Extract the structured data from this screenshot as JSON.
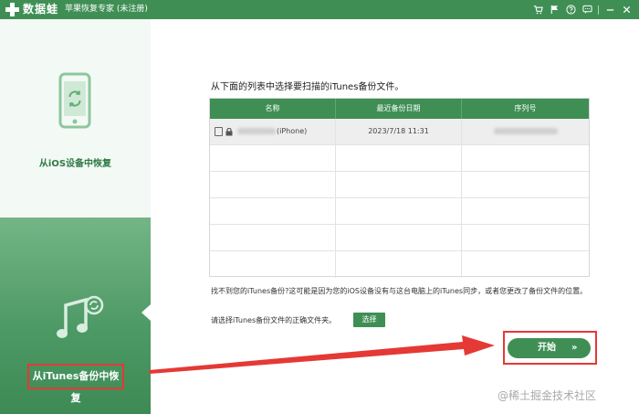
{
  "window": {
    "app_name": "数据蛙",
    "title": "苹果恢复专家 (未注册)",
    "icons": [
      "cart-icon",
      "flag-icon",
      "help-icon",
      "chat-icon",
      "minimize-icon",
      "close-icon"
    ]
  },
  "sidebar": {
    "items": [
      {
        "label": "从iOS设备中恢复",
        "icon": "phone-restore-icon",
        "active": false
      },
      {
        "label": "从iTunes备份中恢复",
        "icon": "itunes-music-icon",
        "active": true
      }
    ]
  },
  "main": {
    "instruction": "从下面的列表中选择要扫描的iTunes备份文件。",
    "table": {
      "columns": [
        "名称",
        "最近备份日期",
        "序列号"
      ],
      "rows": [
        {
          "name_suffix": "(iPhone)",
          "date": "2023/7/18 11:31",
          "selected": true
        }
      ],
      "empty_rows": 5
    },
    "note": "找不到您的iTunes备份?这可能是因为您的iOS设备没有与这台电脑上的iTunes同步，或者您更改了备份文件的位置。",
    "choose_label": "请选择iTunes备份文件的正确文件夹。",
    "choose_button": "选择",
    "start_button": "开始",
    "start_chevron": "»"
  },
  "watermark": "@稀土掘金技术社区",
  "colors": {
    "brand": "#3f8f55",
    "highlight": "#e53935"
  }
}
